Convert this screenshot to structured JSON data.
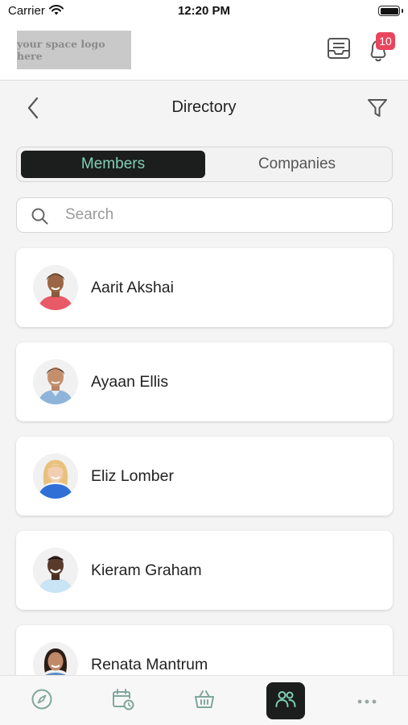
{
  "status_bar": {
    "carrier": "Carrier",
    "time": "12:20 PM"
  },
  "header": {
    "logo_text": "your space logo here",
    "notification_count": "10"
  },
  "title_bar": {
    "title": "Directory"
  },
  "segmented": {
    "members_label": "Members",
    "companies_label": "Companies",
    "selected": "Members"
  },
  "search": {
    "placeholder": "Search",
    "value": ""
  },
  "members": [
    {
      "name": "Aarit Akshai"
    },
    {
      "name": "Ayaan Ellis"
    },
    {
      "name": "Eliz Lomber"
    },
    {
      "name": "Kieram Graham"
    },
    {
      "name": "Renata Mantrum"
    }
  ],
  "bottom_nav": {
    "items": [
      {
        "icon": "compass-icon"
      },
      {
        "icon": "calendar-clock-icon"
      },
      {
        "icon": "basket-icon"
      },
      {
        "icon": "people-icon",
        "active": true
      },
      {
        "icon": "more-dots-icon"
      }
    ]
  },
  "colors": {
    "accent": "#7fcfb5",
    "dark": "#1c1d1d",
    "badge": "#e8455d",
    "icon_tint": "#7fa89c"
  }
}
